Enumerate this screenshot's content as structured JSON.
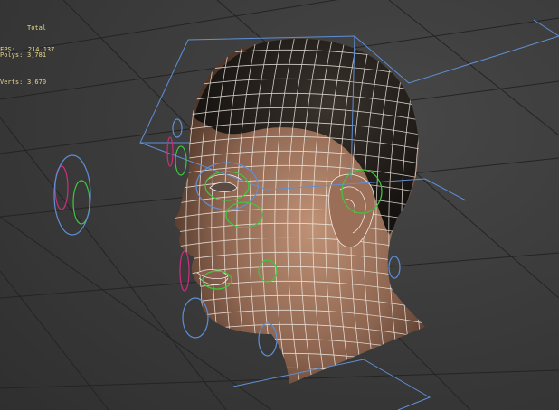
{
  "viewport": {
    "stats": {
      "header": "Total",
      "polys_label": "Polys:",
      "polys_value": "3,781",
      "verts_label": "Verts:",
      "verts_value": "3,670"
    },
    "fps": {
      "label": "FPS:",
      "value": "214.137"
    }
  },
  "colors": {
    "grid_line": "#242424",
    "wire": "#f2ece4",
    "bbox": "#5f8fd6",
    "control_green": "#3ec73e",
    "control_magenta": "#cc2e7d",
    "control_blue": "#5f8fd6",
    "stats_text": "#e7d98a"
  }
}
